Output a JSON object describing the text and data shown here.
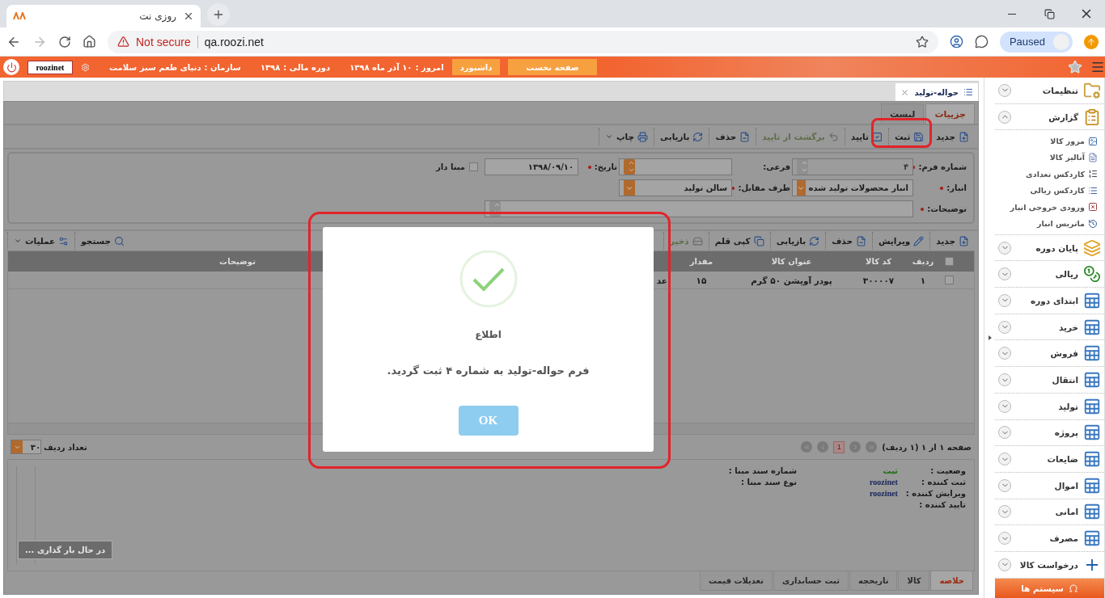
{
  "browser": {
    "tab_title": "روزی نت",
    "security": "Not secure",
    "url": "qa.roozi.net",
    "profile": "Paused"
  },
  "app_bar": {
    "buttons": [
      "صفحه نخست",
      "داشبورد"
    ],
    "info": [
      {
        "label": "امروز :",
        "value": "۱۰ آذر ماه ۱۳۹۸"
      },
      {
        "label": "دوره مالی :",
        "value": "۱۳۹۸"
      },
      {
        "label": "سازمان :",
        "value": "دنیای طعم سبز سلامت"
      }
    ],
    "user": "roozinet"
  },
  "document_tab": {
    "title": "حواله-تولید"
  },
  "view_tabs": [
    {
      "label": "جزییات",
      "selected": true
    },
    {
      "label": "لیست",
      "selected": false
    }
  ],
  "toolbar": [
    {
      "kind": "new",
      "label": "جدید",
      "disabled": false
    },
    {
      "kind": "save",
      "label": "ثبت",
      "disabled": false
    },
    {
      "kind": "confirm",
      "label": "تایید",
      "disabled": false
    },
    {
      "kind": "unconfirm",
      "label": "برگشت از تایید",
      "disabled": true
    },
    {
      "kind": "delete",
      "label": "حذف",
      "disabled": false
    },
    {
      "kind": "restore",
      "label": "بازیابی",
      "disabled": false
    },
    {
      "kind": "print",
      "label": "چاپ",
      "disabled": false,
      "menu": true
    }
  ],
  "form": {
    "fields": [
      {
        "kind": "spinner",
        "label": "شماره فرم:",
        "required": true,
        "value": "۴",
        "disabled": true
      },
      {
        "kind": "spinner",
        "label": "فرعی:",
        "required": false,
        "disabled": false
      },
      {
        "kind": "text",
        "label": "تاریخ:",
        "required": true,
        "value": "۱۳۹۸/۰۹/۱۰",
        "disabled": false
      },
      {
        "kind": "checkbox",
        "label": "مبنا دار",
        "checked": false
      },
      {
        "kind": "select",
        "label": "انبار:",
        "required": true,
        "value": "انبار محصولات تولید شده",
        "disabled": false
      },
      {
        "kind": "select",
        "label": "طرف مقابل:",
        "required": true,
        "value": "سالن تولید",
        "disabled": false
      },
      {
        "kind": "textarea",
        "label": "توضیحات:",
        "required": true
      }
    ]
  },
  "grid_toolbar": {
    "items": [
      {
        "kind": "new",
        "label": "جدید",
        "disabled": false
      },
      {
        "kind": "edit",
        "label": "ویرایش",
        "disabled": false
      },
      {
        "kind": "delete",
        "label": "حذف",
        "disabled": false
      },
      {
        "kind": "restore",
        "label": "بازیابی",
        "disabled": false
      },
      {
        "kind": "copy",
        "label": "کپی قلم",
        "disabled": false
      },
      {
        "kind": "store",
        "label": "ذخیر",
        "disabled": true
      }
    ],
    "tools": [
      {
        "kind": "search",
        "label": "جستجو"
      },
      {
        "kind": "operations",
        "label": "عملیات",
        "menu": true
      }
    ]
  },
  "grid": {
    "header_checked": false,
    "columns": [
      "ردیف",
      "کد کالا",
      "عنوان کالا",
      "مقدار",
      "توضیحات"
    ],
    "rows": [
      {
        "checked": false,
        "row_no": "۱",
        "code": "۳۰۰۰۰۷",
        "title": "پودر آویشن ۵۰ گرم",
        "quantity": "۱۵",
        "column_6": "عد"
      }
    ]
  },
  "pager": {
    "summary": "صفحه ۱ از ۱ (۱ ردیف)",
    "page": "1",
    "rows_label": "تعداد ردیف",
    "rows_per_page": "۳۰"
  },
  "summary": {
    "fields": [
      {
        "kind": "status",
        "label": "وضعیت :",
        "value": "ثبت"
      },
      {
        "kind": "user",
        "label": "ثبت کننده :",
        "value": "roozinet"
      },
      {
        "kind": "user",
        "label": "ویرایش کننده :",
        "value": "roozinet"
      },
      {
        "label": "تایید کننده :"
      }
    ],
    "source_fields": [
      {
        "label": "شماره سند مبنا :"
      },
      {
        "label": "نوع سند مبنا :"
      }
    ],
    "loading": "در حال بار گذاری ..."
  },
  "bottom_tabs": [
    {
      "label": "خلاصه",
      "selected": true
    },
    {
      "label": "کالا",
      "selected": false
    },
    {
      "label": "تاریخچه",
      "selected": false
    },
    {
      "label": "ثبت حسابداری",
      "selected": false
    },
    {
      "label": "تعدیلات قیمت",
      "selected": false
    }
  ],
  "dialog": {
    "title": "اطلاع",
    "message": "فرم حواله-تولید به شماره ۴ ثبت گردید.",
    "button": "OK"
  },
  "sidebar": {
    "sections": [
      {
        "kind": "settings",
        "label": "تنظیمات",
        "expanded": false
      },
      {
        "kind": "report",
        "label": "گزارش",
        "expanded": true,
        "children": [
          {
            "kind": "browse",
            "label": "مرور کالا"
          },
          {
            "kind": "analysis",
            "label": "آنالیز کالا"
          },
          {
            "kind": "qty",
            "label": "کاردکس تعدادی"
          },
          {
            "kind": "rial",
            "label": "کاردکس ریالی"
          },
          {
            "kind": "io",
            "label": "ورودی خروجی انبار"
          },
          {
            "kind": "history",
            "label": "ماتریس انبار"
          }
        ]
      },
      {
        "kind": "layers",
        "label": "پایان دوره",
        "expanded": false
      },
      {
        "kind": "coins",
        "label": "ریالی",
        "expanded": false
      },
      {
        "kind": "table",
        "label": "ابتدای دوره",
        "expanded": false
      },
      {
        "kind": "table",
        "label": "خرید",
        "expanded": false
      },
      {
        "kind": "table",
        "label": "فروش",
        "expanded": false
      },
      {
        "kind": "table",
        "label": "انتقال",
        "expanded": false
      },
      {
        "kind": "table",
        "label": "تولید",
        "expanded": false
      },
      {
        "kind": "table",
        "label": "پروژه",
        "expanded": false
      },
      {
        "kind": "table",
        "label": "ضایعات",
        "expanded": false
      },
      {
        "kind": "table",
        "label": "اموال",
        "expanded": false
      },
      {
        "kind": "table",
        "label": "امانی",
        "expanded": false
      },
      {
        "kind": "table",
        "label": "مصرف",
        "expanded": false
      },
      {
        "kind": "plus",
        "label": "درخواست کالا",
        "expanded": false
      }
    ],
    "footer": "سیستم ها"
  }
}
